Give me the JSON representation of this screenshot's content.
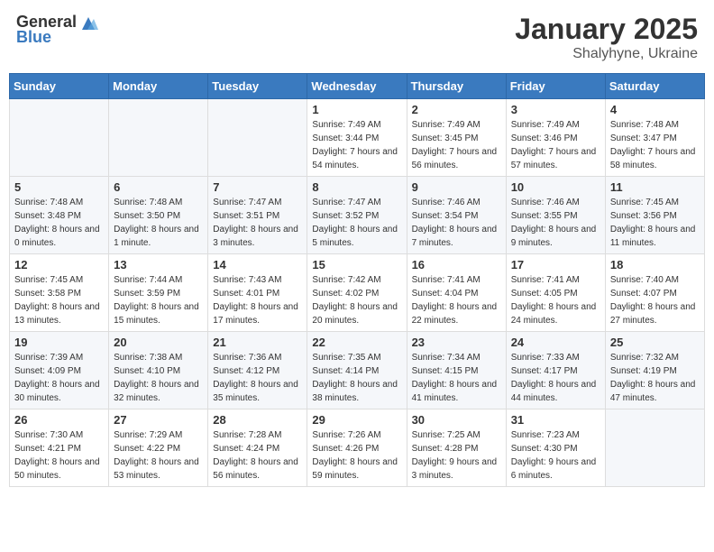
{
  "logo": {
    "text_general": "General",
    "text_blue": "Blue"
  },
  "header": {
    "month": "January 2025",
    "location": "Shalyhyne, Ukraine"
  },
  "weekdays": [
    "Sunday",
    "Monday",
    "Tuesday",
    "Wednesday",
    "Thursday",
    "Friday",
    "Saturday"
  ],
  "weeks": [
    [
      {
        "day": "",
        "sunrise": "",
        "sunset": "",
        "daylight": ""
      },
      {
        "day": "",
        "sunrise": "",
        "sunset": "",
        "daylight": ""
      },
      {
        "day": "",
        "sunrise": "",
        "sunset": "",
        "daylight": ""
      },
      {
        "day": "1",
        "sunrise": "Sunrise: 7:49 AM",
        "sunset": "Sunset: 3:44 PM",
        "daylight": "Daylight: 7 hours and 54 minutes."
      },
      {
        "day": "2",
        "sunrise": "Sunrise: 7:49 AM",
        "sunset": "Sunset: 3:45 PM",
        "daylight": "Daylight: 7 hours and 56 minutes."
      },
      {
        "day": "3",
        "sunrise": "Sunrise: 7:49 AM",
        "sunset": "Sunset: 3:46 PM",
        "daylight": "Daylight: 7 hours and 57 minutes."
      },
      {
        "day": "4",
        "sunrise": "Sunrise: 7:48 AM",
        "sunset": "Sunset: 3:47 PM",
        "daylight": "Daylight: 7 hours and 58 minutes."
      }
    ],
    [
      {
        "day": "5",
        "sunrise": "Sunrise: 7:48 AM",
        "sunset": "Sunset: 3:48 PM",
        "daylight": "Daylight: 8 hours and 0 minutes."
      },
      {
        "day": "6",
        "sunrise": "Sunrise: 7:48 AM",
        "sunset": "Sunset: 3:50 PM",
        "daylight": "Daylight: 8 hours and 1 minute."
      },
      {
        "day": "7",
        "sunrise": "Sunrise: 7:47 AM",
        "sunset": "Sunset: 3:51 PM",
        "daylight": "Daylight: 8 hours and 3 minutes."
      },
      {
        "day": "8",
        "sunrise": "Sunrise: 7:47 AM",
        "sunset": "Sunset: 3:52 PM",
        "daylight": "Daylight: 8 hours and 5 minutes."
      },
      {
        "day": "9",
        "sunrise": "Sunrise: 7:46 AM",
        "sunset": "Sunset: 3:54 PM",
        "daylight": "Daylight: 8 hours and 7 minutes."
      },
      {
        "day": "10",
        "sunrise": "Sunrise: 7:46 AM",
        "sunset": "Sunset: 3:55 PM",
        "daylight": "Daylight: 8 hours and 9 minutes."
      },
      {
        "day": "11",
        "sunrise": "Sunrise: 7:45 AM",
        "sunset": "Sunset: 3:56 PM",
        "daylight": "Daylight: 8 hours and 11 minutes."
      }
    ],
    [
      {
        "day": "12",
        "sunrise": "Sunrise: 7:45 AM",
        "sunset": "Sunset: 3:58 PM",
        "daylight": "Daylight: 8 hours and 13 minutes."
      },
      {
        "day": "13",
        "sunrise": "Sunrise: 7:44 AM",
        "sunset": "Sunset: 3:59 PM",
        "daylight": "Daylight: 8 hours and 15 minutes."
      },
      {
        "day": "14",
        "sunrise": "Sunrise: 7:43 AM",
        "sunset": "Sunset: 4:01 PM",
        "daylight": "Daylight: 8 hours and 17 minutes."
      },
      {
        "day": "15",
        "sunrise": "Sunrise: 7:42 AM",
        "sunset": "Sunset: 4:02 PM",
        "daylight": "Daylight: 8 hours and 20 minutes."
      },
      {
        "day": "16",
        "sunrise": "Sunrise: 7:41 AM",
        "sunset": "Sunset: 4:04 PM",
        "daylight": "Daylight: 8 hours and 22 minutes."
      },
      {
        "day": "17",
        "sunrise": "Sunrise: 7:41 AM",
        "sunset": "Sunset: 4:05 PM",
        "daylight": "Daylight: 8 hours and 24 minutes."
      },
      {
        "day": "18",
        "sunrise": "Sunrise: 7:40 AM",
        "sunset": "Sunset: 4:07 PM",
        "daylight": "Daylight: 8 hours and 27 minutes."
      }
    ],
    [
      {
        "day": "19",
        "sunrise": "Sunrise: 7:39 AM",
        "sunset": "Sunset: 4:09 PM",
        "daylight": "Daylight: 8 hours and 30 minutes."
      },
      {
        "day": "20",
        "sunrise": "Sunrise: 7:38 AM",
        "sunset": "Sunset: 4:10 PM",
        "daylight": "Daylight: 8 hours and 32 minutes."
      },
      {
        "day": "21",
        "sunrise": "Sunrise: 7:36 AM",
        "sunset": "Sunset: 4:12 PM",
        "daylight": "Daylight: 8 hours and 35 minutes."
      },
      {
        "day": "22",
        "sunrise": "Sunrise: 7:35 AM",
        "sunset": "Sunset: 4:14 PM",
        "daylight": "Daylight: 8 hours and 38 minutes."
      },
      {
        "day": "23",
        "sunrise": "Sunrise: 7:34 AM",
        "sunset": "Sunset: 4:15 PM",
        "daylight": "Daylight: 8 hours and 41 minutes."
      },
      {
        "day": "24",
        "sunrise": "Sunrise: 7:33 AM",
        "sunset": "Sunset: 4:17 PM",
        "daylight": "Daylight: 8 hours and 44 minutes."
      },
      {
        "day": "25",
        "sunrise": "Sunrise: 7:32 AM",
        "sunset": "Sunset: 4:19 PM",
        "daylight": "Daylight: 8 hours and 47 minutes."
      }
    ],
    [
      {
        "day": "26",
        "sunrise": "Sunrise: 7:30 AM",
        "sunset": "Sunset: 4:21 PM",
        "daylight": "Daylight: 8 hours and 50 minutes."
      },
      {
        "day": "27",
        "sunrise": "Sunrise: 7:29 AM",
        "sunset": "Sunset: 4:22 PM",
        "daylight": "Daylight: 8 hours and 53 minutes."
      },
      {
        "day": "28",
        "sunrise": "Sunrise: 7:28 AM",
        "sunset": "Sunset: 4:24 PM",
        "daylight": "Daylight: 8 hours and 56 minutes."
      },
      {
        "day": "29",
        "sunrise": "Sunrise: 7:26 AM",
        "sunset": "Sunset: 4:26 PM",
        "daylight": "Daylight: 8 hours and 59 minutes."
      },
      {
        "day": "30",
        "sunrise": "Sunrise: 7:25 AM",
        "sunset": "Sunset: 4:28 PM",
        "daylight": "Daylight: 9 hours and 3 minutes."
      },
      {
        "day": "31",
        "sunrise": "Sunrise: 7:23 AM",
        "sunset": "Sunset: 4:30 PM",
        "daylight": "Daylight: 9 hours and 6 minutes."
      },
      {
        "day": "",
        "sunrise": "",
        "sunset": "",
        "daylight": ""
      }
    ]
  ]
}
